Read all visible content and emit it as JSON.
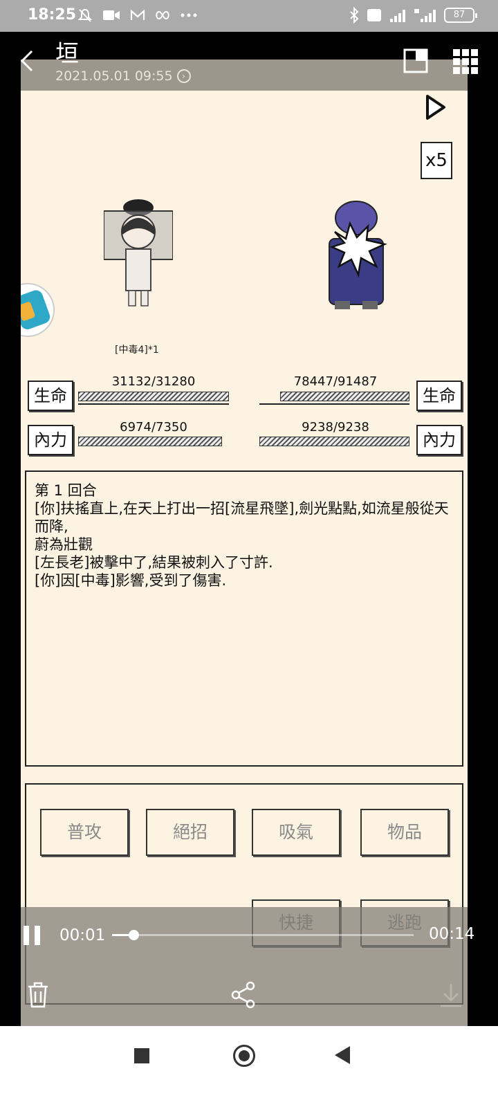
{
  "status_bar": {
    "time": "18:25",
    "battery": "87",
    "icons_left": [
      "mute-icon",
      "video-icon",
      "mail-icon",
      "infinity-icon",
      "more-icon"
    ],
    "icons_right": [
      "bluetooth-icon",
      "volte-icon",
      "signal-icon",
      "4g-signal-icon",
      "battery-icon"
    ]
  },
  "header": {
    "title": "垣",
    "subtitle": "2021.05.01 09:55"
  },
  "game": {
    "speed_label": "x5",
    "status_effect": "[中毒4]*1",
    "player": {
      "hp_label": "生命",
      "hp_value": "31132/31280",
      "mp_label": "內力",
      "mp_value": "6974/7350",
      "hp_fraction": 0.995,
      "mp_fraction": 0.949
    },
    "enemy": {
      "hp_label": "生命",
      "hp_value": "78447/91487",
      "mp_label": "內力",
      "mp_value": "9238/9238",
      "hp_fraction": 0.857,
      "mp_fraction": 1.0
    },
    "log": {
      "lines": [
        "第 1 回合",
        "[你]扶搖直上,在天上打出一招[流星飛墜],劍光點點,如流星般從天而降,",
        "蔚為壯觀",
        "[左長老]被擊中了,結果被刺入了寸許.",
        "[你]因[中毒]影響,受到了傷害."
      ]
    },
    "actions": {
      "attack": "普攻",
      "ultimate": "絕招",
      "absorb": "吸氣",
      "items": "物品",
      "shortcut": "快捷",
      "flee": "逃跑"
    }
  },
  "video": {
    "current_time": "00:01",
    "total_time": "00:14",
    "progress": 0.07
  }
}
